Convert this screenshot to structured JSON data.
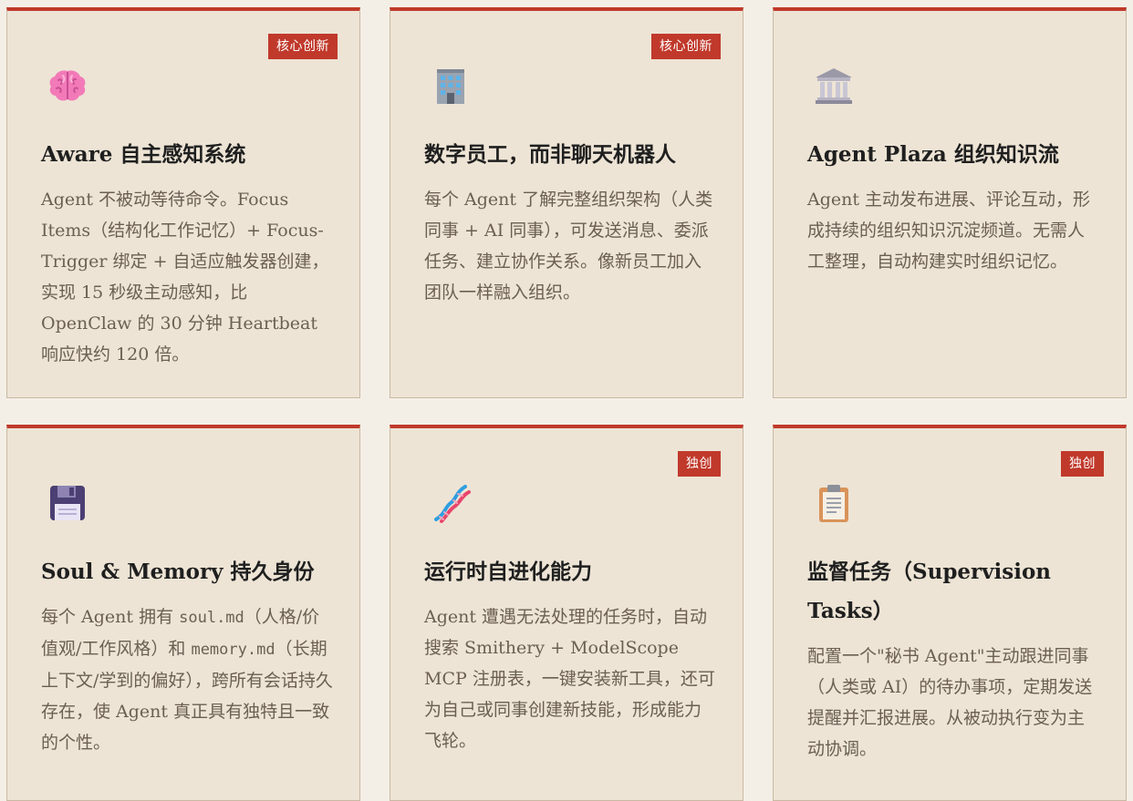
{
  "cards": [
    {
      "badge": "核心创新",
      "icon": "brain-icon",
      "title": "Aware 自主感知系统",
      "description": "Agent 不被动等待命令。Focus Items（结构化工作记忆）+ Focus-Trigger 绑定 + 自适应触发器创建，实现 15 秒级主动感知，比 OpenClaw 的 30 分钟 Heartbeat 响应快约 120 倍。"
    },
    {
      "badge": "核心创新",
      "icon": "office-building-icon",
      "title": "数字员工，而非聊天机器人",
      "description": "每个 Agent 了解完整组织架构（人类同事 + AI 同事），可发送消息、委派任务、建立协作关系。像新员工加入团队一样融入组织。"
    },
    {
      "badge": "",
      "icon": "classical-building-icon",
      "title": "Agent Plaza 组织知识流",
      "description": "Agent 主动发布进展、评论互动，形成持续的组织知识沉淀频道。无需人工整理，自动构建实时组织记忆。"
    },
    {
      "badge": "",
      "icon": "floppy-disk-icon",
      "title": "Soul & Memory 持久身份",
      "description_parts": {
        "p1": "每个 Agent 拥有 ",
        "code1": "soul.md",
        "p2": "（人格/价值观/工作风格）和 ",
        "code2": "memory.md",
        "p3": "（长期上下文/学到的偏好），跨所有会话持久存在，使 Agent 真正具有独特且一致的个性。"
      }
    },
    {
      "badge": "独创",
      "icon": "dna-icon",
      "title": "运行时自进化能力",
      "description": "Agent 遭遇无法处理的任务时，自动搜索 Smithery + ModelScope MCP 注册表，一键安装新工具，还可为自己或同事创建新技能，形成能力飞轮。"
    },
    {
      "badge": "独创",
      "icon": "clipboard-icon",
      "title": "监督任务（Supervision Tasks）",
      "description": "配置一个\"秘书 Agent\"主动跟进同事（人类或 AI）的待办事项，定期发送提醒并汇报进展。从被动执行变为主动协调。"
    }
  ]
}
